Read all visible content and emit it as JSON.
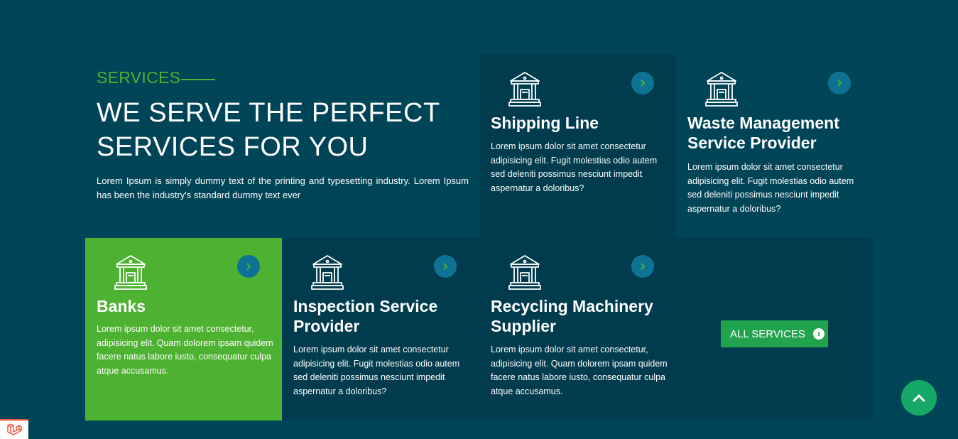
{
  "intro": {
    "kicker": "SERVICES",
    "heading_line1": "WE SERVE THE PERFECT",
    "heading_line2": "SERVICES FOR YOU",
    "text": "Lorem Ipsum is simply dummy text of the printing and typesetting industry. Lorem Ipsum has been the industry's standard dummy text ever"
  },
  "services": [
    {
      "title": "Shipping Line",
      "desc": "Lorem ipsum dolor sit amet consectetur adipisicing elit. Fugit molestias odio autem sed deleniti possimus nesciunt impedit aspernatur a doloribus?"
    },
    {
      "title": "Waste Management Service Provider",
      "desc": "Lorem ipsum dolor sit amet consectetur adipisicing elit. Fugit molestias odio autem sed deleniti possimus nesciunt impedit aspernatur a doloribus?"
    },
    {
      "title": "Banks",
      "desc": "Lorem ipsum dolor sit amet consectetur, adipisicing elit. Quam dolorem ipsam quidem facere natus labore iusto, consequatur culpa atque accusamus."
    },
    {
      "title": "Inspection Service Provider",
      "desc": "Lorem ipsum dolor sit amet consectetur adipisicing elit. Fugit molestias odio autem sed deleniti possimus nesciunt impedit aspernatur a doloribus?"
    },
    {
      "title": "Recycling Machinery Supplier",
      "desc": "Lorem ipsum dolor sit amet consectetur, adipisicing elit. Quam dolorem ipsam quidem facere natus labore iusto, consequatur culpa atque accusamus."
    }
  ],
  "all_services_label": "ALL SERVICES",
  "icons": {
    "service": "bank-building-icon",
    "card_link": "chevron-right-icon",
    "all_services": "info-icon",
    "scroll_top": "chevron-up-icon",
    "corner": "laravel-logo-icon"
  },
  "colors": {
    "background": "#004457",
    "card_dark": "#003c4e",
    "accent_green": "#4db131",
    "button_green": "#21a34d",
    "arrow_circle": "#0e7294",
    "scroll_top": "#16a866"
  }
}
